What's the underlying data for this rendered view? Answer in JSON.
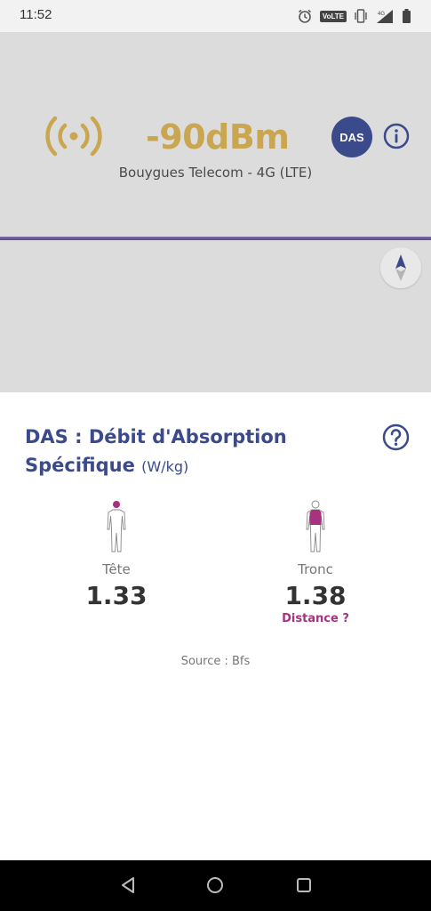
{
  "status_bar": {
    "time": "11:52",
    "volte": "VoLTE",
    "icons": [
      "alarm-icon",
      "vibrate-icon",
      "signal-4g-icon",
      "battery-icon"
    ]
  },
  "signal": {
    "value": "-90dBm",
    "operator": "Bouygues Telecom - 4G (LTE)",
    "badge": "DAS",
    "accent_color": "#c9a64f"
  },
  "das": {
    "title": "DAS : Débit d'Absorption Spécifique",
    "unit": "(W/kg)",
    "color": "#3b4a8b",
    "head_label": "Tête",
    "head_value": "1.33",
    "trunk_label": "Tronc",
    "trunk_value": "1.38",
    "distance_link": "Distance ?",
    "highlight_color": "#a8327f",
    "source": "Source : Bfs"
  },
  "nav": {
    "icons": [
      "back-icon",
      "home-icon",
      "recents-icon"
    ]
  }
}
